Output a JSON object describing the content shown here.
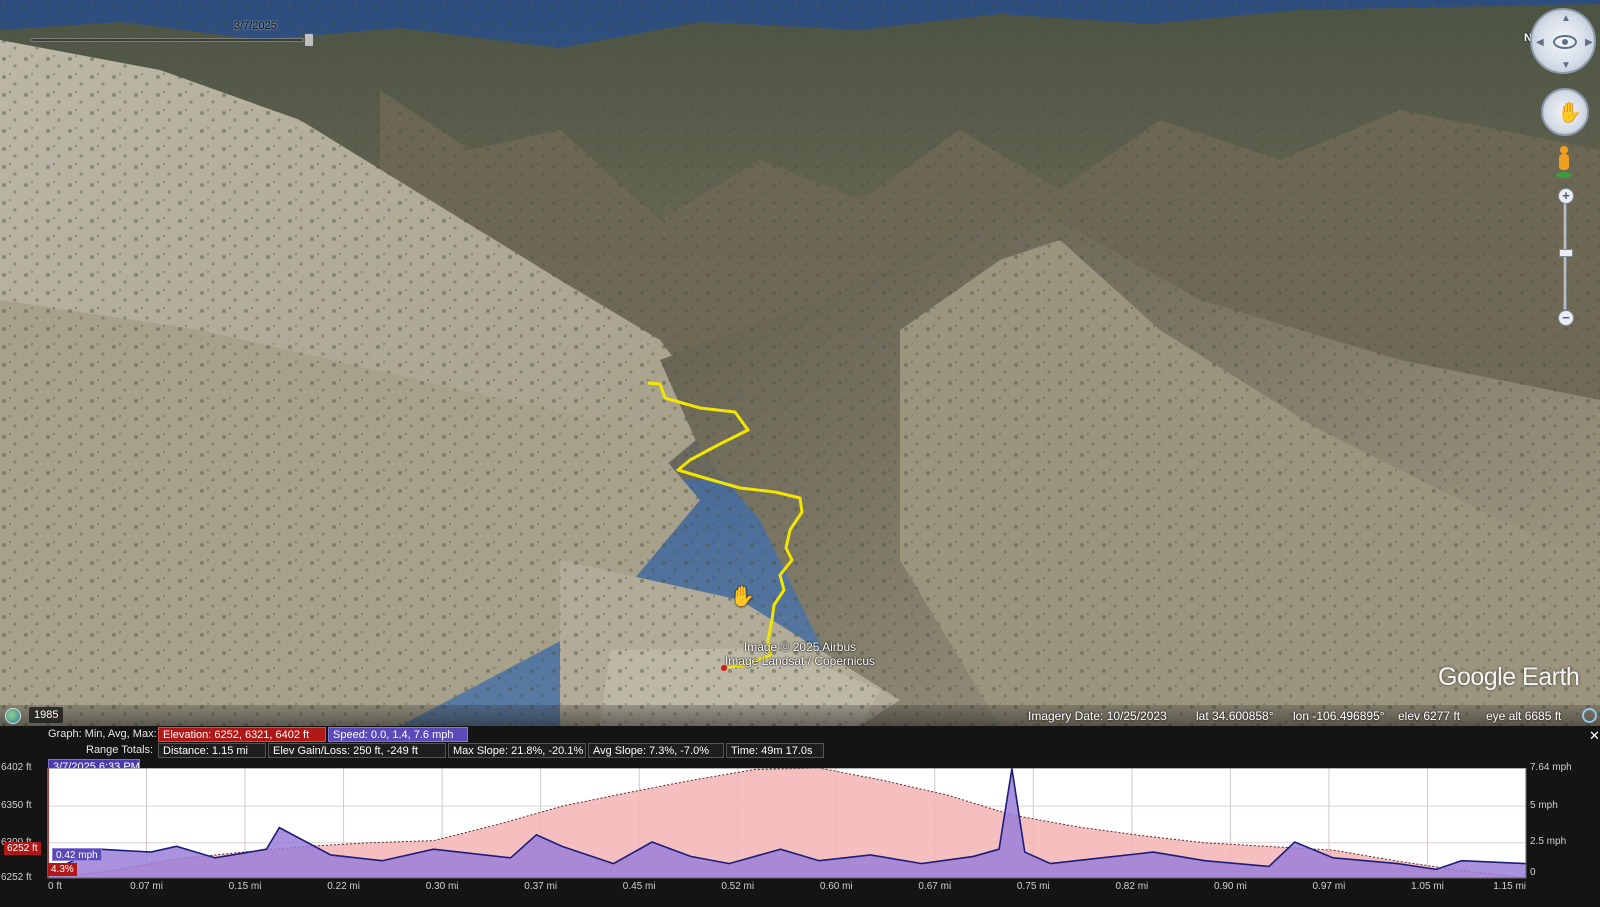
{
  "app": {
    "name": "Google Earth"
  },
  "time_slider": {
    "date": "3/7/2025"
  },
  "viewport": {
    "compass_letter": "N",
    "credits": [
      "Image © 2025 Airbus",
      "Image Landsat / Copernicus"
    ],
    "logo": "Google Earth",
    "cursor": "hand-cursor"
  },
  "status_bar": {
    "historical_year": "1985",
    "imagery_date": "Imagery Date: 10/25/2023",
    "lat": "lat   34.600858°",
    "lon": "lon  -106.496895°",
    "elev": "elev  6277 ft",
    "eye_alt": "eye alt   6685 ft"
  },
  "profile": {
    "close_label": "✕",
    "graph_label": "Graph: Min, Avg, Max:",
    "elevation_summary": "Elevation: 6252, 6321, 6402 ft",
    "speed_summary": "Speed: 0.0, 1.4, 7.6 mph",
    "range_totals_label": "Range Totals:",
    "distance": "Distance: 1.15 mi",
    "elev_gain_loss": "Elev Gain/Loss: 250 ft, -249 ft",
    "max_slope": "Max Slope: 21.8%, -20.1%",
    "avg_slope": "Avg Slope: 7.3%, -7.0%",
    "time": "Time: 49m 17.0s",
    "cursor_datetime": "3/7/2025 6:33 PM",
    "cursor_elevation": "6252 ft",
    "cursor_speed": "0.42 mph",
    "cursor_slope": "4.3%"
  },
  "chart_data": {
    "type": "area",
    "x_unit": "mi",
    "x_ticks": [
      "0 ft",
      "0.07 mi",
      "0.15 mi",
      "0.22 mi",
      "0.30 mi",
      "0.37 mi",
      "0.45 mi",
      "0.52 mi",
      "0.60 mi",
      "0.67 mi",
      "0.75 mi",
      "0.82 mi",
      "0.90 mi",
      "0.97 mi",
      "1.05 mi",
      "1.15 mi"
    ],
    "y_left_ticks": [
      "6402 ft",
      "6350 ft",
      "6300 ft",
      "6252 ft"
    ],
    "y_right_ticks": [
      "7.64 mph",
      "5 mph",
      "2.5 mph",
      "0"
    ],
    "y_left_range": [
      6252,
      6402
    ],
    "y_right_range": [
      0,
      7.64
    ],
    "series": [
      {
        "name": "Elevation",
        "unit": "ft",
        "color": "#f4b4b4",
        "x": [
          0,
          0.05,
          0.1,
          0.15,
          0.2,
          0.25,
          0.3,
          0.35,
          0.4,
          0.45,
          0.5,
          0.55,
          0.6,
          0.65,
          0.7,
          0.75,
          0.8,
          0.85,
          0.9,
          0.95,
          1.0,
          1.05,
          1.1,
          1.15
        ],
        "values": [
          6252,
          6262,
          6278,
          6287,
          6295,
          6300,
          6303,
          6325,
          6350,
          6368,
          6385,
          6400,
          6402,
          6385,
          6365,
          6338,
          6322,
          6310,
          6300,
          6295,
          6290,
          6275,
          6262,
          6252
        ]
      },
      {
        "name": "Speed",
        "unit": "mph",
        "color": "#9b7fd8",
        "x": [
          0,
          0.04,
          0.08,
          0.1,
          0.13,
          0.17,
          0.18,
          0.22,
          0.26,
          0.3,
          0.36,
          0.38,
          0.4,
          0.44,
          0.47,
          0.5,
          0.53,
          0.57,
          0.6,
          0.64,
          0.68,
          0.72,
          0.74,
          0.75,
          0.76,
          0.78,
          0.82,
          0.86,
          0.9,
          0.95,
          0.97,
          1.0,
          1.05,
          1.08,
          1.1,
          1.15
        ],
        "values": [
          0.42,
          2.0,
          1.8,
          2.2,
          1.4,
          2.0,
          3.5,
          1.6,
          1.2,
          2.0,
          1.4,
          3.0,
          2.2,
          1.0,
          2.5,
          1.5,
          1.0,
          2.0,
          1.2,
          1.6,
          1.0,
          1.5,
          2.0,
          7.6,
          1.8,
          1.0,
          1.4,
          1.8,
          1.2,
          0.8,
          2.5,
          1.4,
          1.0,
          0.6,
          1.2,
          1.0
        ]
      }
    ],
    "grid": true,
    "cursor_x": 0
  },
  "colors": {
    "elevation_fill": "#f4b4b4",
    "speed_fill": "#9b7fd8",
    "track": "#f2e600",
    "elevation_badge": "#b01818",
    "speed_badge": "#5b4ab8"
  }
}
